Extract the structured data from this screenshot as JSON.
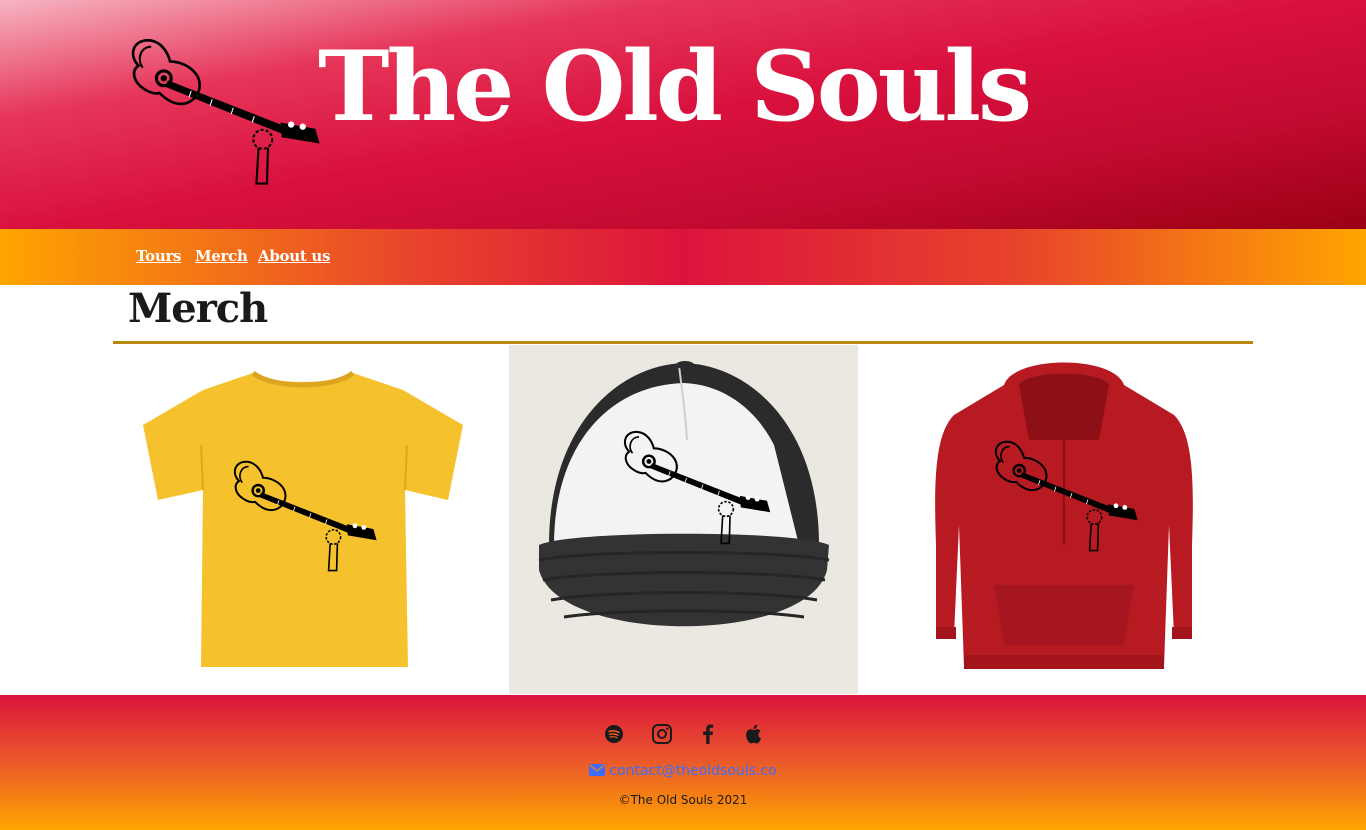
{
  "header": {
    "title": "The Old Souls",
    "logo_icon": "guitar-icon"
  },
  "nav": {
    "items": [
      {
        "label": "Tours"
      },
      {
        "label": "Merch"
      },
      {
        "label": "About us"
      }
    ]
  },
  "main": {
    "page_title": "Merch",
    "products": [
      {
        "type": "t-shirt",
        "color": "#f5c22e"
      },
      {
        "type": "trucker-hat",
        "color": "#2b2b2b"
      },
      {
        "type": "hoodie",
        "color": "#b81a22"
      }
    ]
  },
  "footer": {
    "social_icons": [
      "spotify-icon",
      "instagram-icon",
      "facebook-icon",
      "apple-icon"
    ],
    "email": "contact@theoldsouls.co",
    "copyright": "©The Old Souls 2021"
  },
  "colors": {
    "header_red": "#dc143c",
    "nav_orange": "#ffa500",
    "rule_gold": "#b8860b",
    "link_blue": "#3b6cff"
  }
}
